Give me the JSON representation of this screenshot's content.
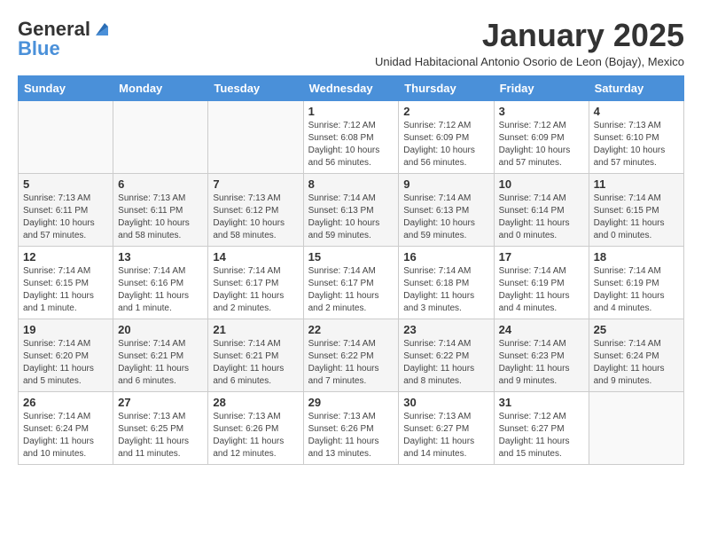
{
  "header": {
    "logo_general": "General",
    "logo_blue": "Blue",
    "month_title": "January 2025",
    "subtitle": "Unidad Habitacional Antonio Osorio de Leon (Bojay), Mexico"
  },
  "days_of_week": [
    "Sunday",
    "Monday",
    "Tuesday",
    "Wednesday",
    "Thursday",
    "Friday",
    "Saturday"
  ],
  "weeks": [
    [
      {
        "day": "",
        "info": ""
      },
      {
        "day": "",
        "info": ""
      },
      {
        "day": "",
        "info": ""
      },
      {
        "day": "1",
        "info": "Sunrise: 7:12 AM\nSunset: 6:08 PM\nDaylight: 10 hours and 56 minutes."
      },
      {
        "day": "2",
        "info": "Sunrise: 7:12 AM\nSunset: 6:09 PM\nDaylight: 10 hours and 56 minutes."
      },
      {
        "day": "3",
        "info": "Sunrise: 7:12 AM\nSunset: 6:09 PM\nDaylight: 10 hours and 57 minutes."
      },
      {
        "day": "4",
        "info": "Sunrise: 7:13 AM\nSunset: 6:10 PM\nDaylight: 10 hours and 57 minutes."
      }
    ],
    [
      {
        "day": "5",
        "info": "Sunrise: 7:13 AM\nSunset: 6:11 PM\nDaylight: 10 hours and 57 minutes."
      },
      {
        "day": "6",
        "info": "Sunrise: 7:13 AM\nSunset: 6:11 PM\nDaylight: 10 hours and 58 minutes."
      },
      {
        "day": "7",
        "info": "Sunrise: 7:13 AM\nSunset: 6:12 PM\nDaylight: 10 hours and 58 minutes."
      },
      {
        "day": "8",
        "info": "Sunrise: 7:14 AM\nSunset: 6:13 PM\nDaylight: 10 hours and 59 minutes."
      },
      {
        "day": "9",
        "info": "Sunrise: 7:14 AM\nSunset: 6:13 PM\nDaylight: 10 hours and 59 minutes."
      },
      {
        "day": "10",
        "info": "Sunrise: 7:14 AM\nSunset: 6:14 PM\nDaylight: 11 hours and 0 minutes."
      },
      {
        "day": "11",
        "info": "Sunrise: 7:14 AM\nSunset: 6:15 PM\nDaylight: 11 hours and 0 minutes."
      }
    ],
    [
      {
        "day": "12",
        "info": "Sunrise: 7:14 AM\nSunset: 6:15 PM\nDaylight: 11 hours and 1 minute."
      },
      {
        "day": "13",
        "info": "Sunrise: 7:14 AM\nSunset: 6:16 PM\nDaylight: 11 hours and 1 minute."
      },
      {
        "day": "14",
        "info": "Sunrise: 7:14 AM\nSunset: 6:17 PM\nDaylight: 11 hours and 2 minutes."
      },
      {
        "day": "15",
        "info": "Sunrise: 7:14 AM\nSunset: 6:17 PM\nDaylight: 11 hours and 2 minutes."
      },
      {
        "day": "16",
        "info": "Sunrise: 7:14 AM\nSunset: 6:18 PM\nDaylight: 11 hours and 3 minutes."
      },
      {
        "day": "17",
        "info": "Sunrise: 7:14 AM\nSunset: 6:19 PM\nDaylight: 11 hours and 4 minutes."
      },
      {
        "day": "18",
        "info": "Sunrise: 7:14 AM\nSunset: 6:19 PM\nDaylight: 11 hours and 4 minutes."
      }
    ],
    [
      {
        "day": "19",
        "info": "Sunrise: 7:14 AM\nSunset: 6:20 PM\nDaylight: 11 hours and 5 minutes."
      },
      {
        "day": "20",
        "info": "Sunrise: 7:14 AM\nSunset: 6:21 PM\nDaylight: 11 hours and 6 minutes."
      },
      {
        "day": "21",
        "info": "Sunrise: 7:14 AM\nSunset: 6:21 PM\nDaylight: 11 hours and 6 minutes."
      },
      {
        "day": "22",
        "info": "Sunrise: 7:14 AM\nSunset: 6:22 PM\nDaylight: 11 hours and 7 minutes."
      },
      {
        "day": "23",
        "info": "Sunrise: 7:14 AM\nSunset: 6:22 PM\nDaylight: 11 hours and 8 minutes."
      },
      {
        "day": "24",
        "info": "Sunrise: 7:14 AM\nSunset: 6:23 PM\nDaylight: 11 hours and 9 minutes."
      },
      {
        "day": "25",
        "info": "Sunrise: 7:14 AM\nSunset: 6:24 PM\nDaylight: 11 hours and 9 minutes."
      }
    ],
    [
      {
        "day": "26",
        "info": "Sunrise: 7:14 AM\nSunset: 6:24 PM\nDaylight: 11 hours and 10 minutes."
      },
      {
        "day": "27",
        "info": "Sunrise: 7:13 AM\nSunset: 6:25 PM\nDaylight: 11 hours and 11 minutes."
      },
      {
        "day": "28",
        "info": "Sunrise: 7:13 AM\nSunset: 6:26 PM\nDaylight: 11 hours and 12 minutes."
      },
      {
        "day": "29",
        "info": "Sunrise: 7:13 AM\nSunset: 6:26 PM\nDaylight: 11 hours and 13 minutes."
      },
      {
        "day": "30",
        "info": "Sunrise: 7:13 AM\nSunset: 6:27 PM\nDaylight: 11 hours and 14 minutes."
      },
      {
        "day": "31",
        "info": "Sunrise: 7:12 AM\nSunset: 6:27 PM\nDaylight: 11 hours and 15 minutes."
      },
      {
        "day": "",
        "info": ""
      }
    ]
  ]
}
